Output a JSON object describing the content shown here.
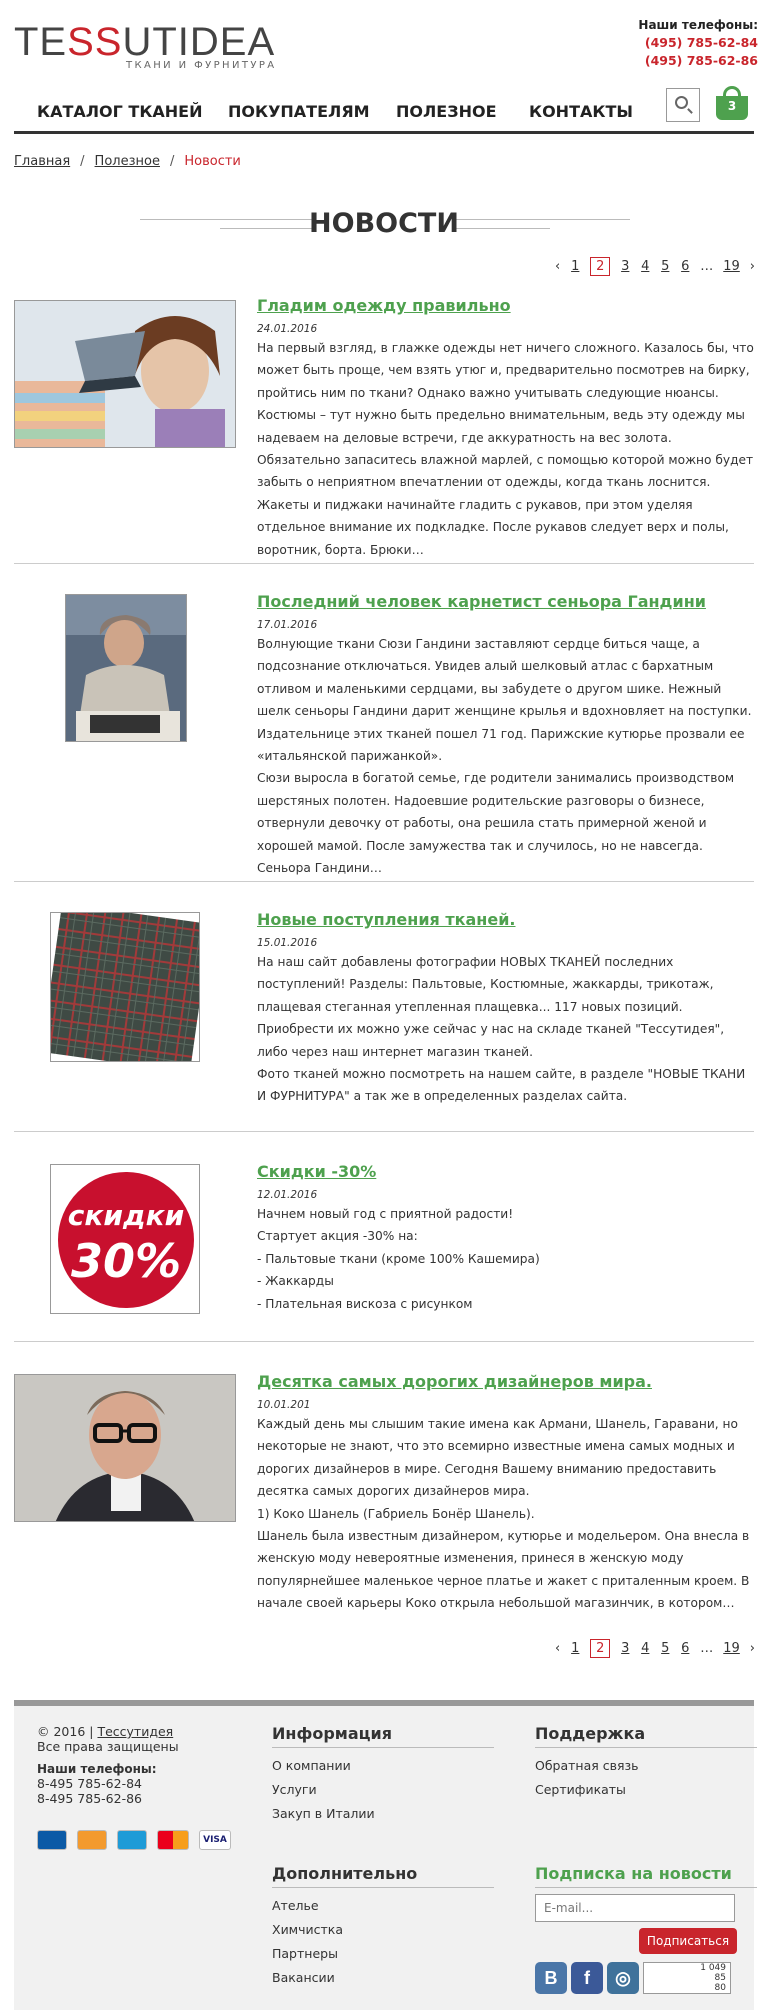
{
  "brand": {
    "logo_a": "TE",
    "logo_ss": "SS",
    "logo_b": "UTIDEA",
    "tagline": "Ткани и фурнитура"
  },
  "header": {
    "phones_title": "Наши телефоны:",
    "phone1": "(495) 785-62-84",
    "phone2": "(495) 785-62-86"
  },
  "nav": [
    {
      "label": "Каталог тканей"
    },
    {
      "label": "Покупателям"
    },
    {
      "label": "Полезное"
    },
    {
      "label": "Контакты"
    }
  ],
  "cart": {
    "count": "3"
  },
  "breadcrumb": {
    "home": "Главная",
    "section": "Полезное",
    "current": "Новости",
    "sep": "/"
  },
  "page": {
    "title": "НОВОСТИ"
  },
  "pager": {
    "prev": "‹",
    "next": "›",
    "pages": [
      "1",
      "2",
      "3",
      "4",
      "5",
      "6",
      "…",
      "19"
    ],
    "current": "2"
  },
  "news": [
    {
      "title": "Гладим одежду правильно",
      "date": "24.01.2016",
      "text": [
        "На первый взгляд, в глажке одежды нет ничего сложного. Казалось бы, что может быть проще, чем взять утюг и, предварительно посмотрев на бирку, пройтись ним по ткани? Однако важно учитывать следующие нюансы.",
        "Костюмы – тут нужно быть предельно внимательным, ведь эту одежду мы надеваем на деловые встречи, где аккуратность на вес золота. Обязательно запаситесь влажной марлей, с помощью которой можно будет забыть о неприятном впечатлении от одежды, когда ткань лоснится. Жакеты и пиджаки начинайте гладить с рукавов, при этом уделяя отдельное внимание их подкладке. После рукавов следует верх и полы, воротник, борта. Брюки…"
      ]
    },
    {
      "title": "Последний человек карнетист сеньора Гандини",
      "date": "17.01.2016",
      "text": [
        "Волнующие ткани Сюзи Гандини заставляют сердце биться чаще, а подсознание отключаться. Увидев алый шелковый атлас с бархатным отливом и маленькими сердцами, вы забудете о другом шике. Нежный шелк сеньоры Гандини дарит женщине крылья и вдохновляет на поступки.",
        "Издательнице этих тканей пошел 71 год. Парижские кутюрье прозвали ее «итальянской парижанкой».",
        "Сюзи выросла в богатой семье, где родители занимались производством шерстяных полотен. Надоевшие родительские разговоры о бизнесе, отвернули девочку от работы, она решила стать примерной женой и хорошей мамой. После замужества так и случилось, но не навсегда. Сеньора Гандини…"
      ]
    },
    {
      "title": "Новые поступления тканей.",
      "date": "15.01.2016",
      "text": [
        "На наш сайт добавлены фотографии НОВЫХ ТКАНЕЙ последних поступлений! Разделы: Пальтовые, Костюмные, жаккарды, трикотаж, плащевая стеганная утепленная плащевка... 117 новых позиций.",
        "Приобрести их можно уже сейчас у нас на складе тканей \"Тессутидея\", либо через наш интернет магазин тканей.",
        "Фото тканей можно посмотреть на нашем сайте, в разделе \"НОВЫЕ ТКАНИ И ФУРНИТУРА\" а так же в определенных разделах сайта."
      ]
    },
    {
      "title": "Скидки -30%",
      "date": "12.01.2016",
      "text": [
        "Начнем новый год с приятной радости!",
        "Стартует акция -30% на:",
        "- Пальтовые ткани (кроме 100% Кашемира)",
        "- Жаккарды",
        "- Плательная вискоза с рисунком"
      ],
      "badge_word": "скидки",
      "badge_num": "30%"
    },
    {
      "title": "Десятка самых дорогих дизайнеров мира.",
      "date": "10.01.201",
      "text": [
        "Каждый день мы слышим такие имена как Армани, Шанель, Гаравани, но некоторые не знают, что это всемирно известные имена самых модных и дорогих дизайнеров в мире. Сегодня Вашему вниманию предоставить десятка самых дорогих дизайнеров мира.",
        "1) Коко Шанель (Габриель Бонёр Шанель).",
        "Шанель была известным дизайнером, кутюрье и модельером. Она внесла в женскую моду невероятные изменения, принеся в женскую моду популярнейшее маленькое черное платье и жакет с приталенным кроем. В начале своей карьеры Коко открыла небольшой магазинчик, в котором…"
      ]
    }
  ],
  "footer": {
    "copyright": "© 2016 |",
    "copyright_link": "Тессутидея",
    "rights": "Все права защищены",
    "phones_title": "Наши телефоны:",
    "phone1": "8-495 785-62-84",
    "phone2": "8-495 785-62-86",
    "info_title": "Информация",
    "info_links": [
      "О компании",
      "Услуги",
      "Закуп в Италии"
    ],
    "extra_title": "Дополнительно",
    "extra_links": [
      "Ателье",
      "Химчистка",
      "Партнеры",
      "Вакансии"
    ],
    "support_title": "Поддержка",
    "support_links": [
      "Обратная связь",
      "Сертификаты"
    ],
    "subscribe_title": "Подписка на новости",
    "email_placeholder": "E-mail...",
    "subscribe_button": "Подписаться",
    "counter": [
      "1 049",
      "85",
      "80"
    ]
  }
}
